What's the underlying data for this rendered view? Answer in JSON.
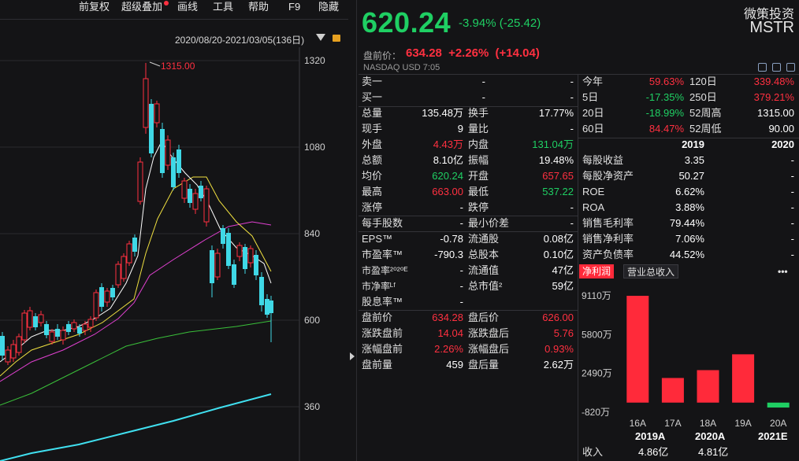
{
  "menu": {
    "items": [
      "前复权",
      "超级叠加",
      "画线",
      "工具",
      "帮助",
      "F9",
      "隐藏"
    ]
  },
  "chart": {
    "date_range": "2020/08/20-2021/03/05(136日)",
    "y_ticks": [
      "1320",
      "1080",
      "840",
      "600",
      "360"
    ],
    "high_marker": "1315.00"
  },
  "quote": {
    "price": "620.24",
    "change": "-3.94% (-25.42)",
    "name": "微策投资",
    "ticker": "MSTR",
    "premarket_label": "盘前价：",
    "premarket_price": "634.28",
    "premarket_change": "+2.26%",
    "premarket_change_abs": "(+14.04)",
    "exchange": "NASDAQ  USD  7:05"
  },
  "orderbook": [
    {
      "label": "卖一",
      "v1": "-",
      "v2": "-"
    },
    {
      "label": "买一",
      "v1": "-",
      "v2": "-"
    }
  ],
  "stats": [
    {
      "l1": "总量",
      "v1": "135.48万",
      "c1": "white",
      "l2": "换手",
      "v2": "17.77%",
      "c2": "white"
    },
    {
      "l1": "现手",
      "v1": "9",
      "c1": "white",
      "l2": "量比",
      "v2": "-",
      "c2": "white"
    },
    {
      "l1": "外盘",
      "v1": "4.43万",
      "c1": "red",
      "l2": "内盘",
      "v2": "131.04万",
      "c2": "green"
    },
    {
      "l1": "总额",
      "v1": "8.10亿",
      "c1": "white",
      "l2": "振幅",
      "v2": "19.48%",
      "c2": "white"
    },
    {
      "l1": "均价",
      "v1": "620.24",
      "c1": "green",
      "l2": "开盘",
      "v2": "657.65",
      "c2": "red"
    },
    {
      "l1": "最高",
      "v1": "663.00",
      "c1": "red",
      "l2": "最低",
      "v2": "537.22",
      "c2": "green"
    },
    {
      "l1": "涨停",
      "v1": "-",
      "c1": "white",
      "l2": "跌停",
      "v2": "-",
      "c2": "white"
    },
    {
      "l1": "每手股数",
      "v1": "-",
      "c1": "white",
      "l2": "最小价差",
      "v2": "-",
      "c2": "white"
    },
    {
      "l1": "EPS™",
      "v1": "-0.78",
      "c1": "white",
      "l2": "流通股",
      "v2": "0.08亿",
      "c2": "white"
    },
    {
      "l1": "市盈率™",
      "v1": "-790.3",
      "c1": "white",
      "l2": "总股本",
      "v2": "0.10亿",
      "c2": "white"
    },
    {
      "l1": "市盈率²⁰²⁰ᴱ",
      "v1": "-",
      "c1": "white",
      "l2": "流通值",
      "v2": "47亿",
      "c2": "white"
    },
    {
      "l1": "市净率ᴸᶠ",
      "v1": "-",
      "c1": "white",
      "l2": "总市值²",
      "v2": "59亿",
      "c2": "white"
    },
    {
      "l1": "股息率™",
      "v1": "-",
      "c1": "white",
      "l2": "",
      "v2": "",
      "c2": "white"
    },
    {
      "l1": "盘前价",
      "v1": "634.28",
      "c1": "red",
      "l2": "盘后价",
      "v2": "626.00",
      "c2": "red"
    },
    {
      "l1": "涨跌盘前",
      "v1": "14.04",
      "c1": "red",
      "l2": "涨跌盘后",
      "v2": "5.76",
      "c2": "red"
    },
    {
      "l1": "涨幅盘前",
      "v1": "2.26%",
      "c1": "red",
      "l2": "涨幅盘后",
      "v2": "0.93%",
      "c2": "red"
    },
    {
      "l1": "盘前量",
      "v1": "459",
      "c1": "white",
      "l2": "盘后量",
      "v2": "2.62万",
      "c2": "white"
    }
  ],
  "periods": [
    {
      "l1": "今年",
      "v1": "59.63%",
      "c1": "red",
      "l2": "120日",
      "v2": "339.48%",
      "c2": "red"
    },
    {
      "l1": "5日",
      "v1": "-17.35%",
      "c1": "green",
      "l2": "250日",
      "v2": "379.21%",
      "c2": "red"
    },
    {
      "l1": "20日",
      "v1": "-18.99%",
      "c1": "green",
      "l2": "52周高",
      "v2": "1315.00",
      "c2": "white"
    },
    {
      "l1": "60日",
      "v1": "84.47%",
      "c1": "red",
      "l2": "52周低",
      "v2": "90.00",
      "c2": "white"
    }
  ],
  "fundamentals": {
    "year1": "2019",
    "year2": "2020",
    "rows": [
      {
        "label": "每股收益",
        "v1": "3.35",
        "v2": "-"
      },
      {
        "label": "每股净资产",
        "v1": "50.27",
        "v2": "-"
      },
      {
        "label": "ROE",
        "v1": "6.62%",
        "v2": "-"
      },
      {
        "label": "ROA",
        "v1": "3.88%",
        "v2": "-"
      },
      {
        "label": "销售毛利率",
        "v1": "79.44%",
        "v2": "-"
      },
      {
        "label": "销售净利率",
        "v1": "7.06%",
        "v2": "-"
      },
      {
        "label": "资产负债率",
        "v1": "44.52%",
        "v2": "-"
      }
    ]
  },
  "mini_tabs": [
    "净利润",
    "营业总收入"
  ],
  "more": "•••",
  "chart_data": {
    "type": "bar",
    "categories": [
      "16A",
      "17A",
      "18A",
      "19A",
      "20A"
    ],
    "values": [
      9110,
      2100,
      2770,
      4120,
      -420
    ],
    "y_ticks": [
      "9110万",
      "5800万",
      "2490万",
      "-820万"
    ],
    "ylim": [
      -820,
      9110
    ],
    "colors": [
      "#ff2a3a",
      "#ff2a3a",
      "#ff2a3a",
      "#ff2a3a",
      "#1fcf63"
    ]
  },
  "bottom": {
    "years": [
      "2019A",
      "2020A",
      "2021E"
    ],
    "revenue_label": "收入",
    "revenue_values": [
      "4.86亿",
      "4.81亿",
      ""
    ]
  }
}
